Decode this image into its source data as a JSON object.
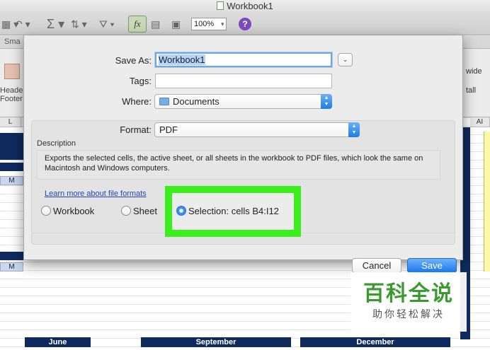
{
  "window": {
    "title": "Workbook1"
  },
  "toolbar": {
    "zoom": "100%",
    "function_label": "fx",
    "help_label": "?"
  },
  "ribbon": {
    "tab_label": "Sma",
    "header_footer_label": "Header\nFooter",
    "wide_label": "wide",
    "tall_label": "tall"
  },
  "sheet": {
    "col_left": "L",
    "col_right": "AI",
    "cell_m1": "M",
    "cell_m2": "M",
    "months": [
      "June",
      "September",
      "December"
    ]
  },
  "dialog": {
    "save_as_label": "Save As:",
    "save_as_value": "Workbook1",
    "tags_label": "Tags:",
    "tags_value": "",
    "where_label": "Where:",
    "where_value": "Documents",
    "format_label": "Format:",
    "format_value": "PDF",
    "description_title": "Description",
    "description_text": "Exports the selected cells, the active sheet, or all sheets in the workbook to PDF files, which look the same on Macintosh and Windows computers.",
    "learn_link": "Learn more about file formats",
    "radio_options": [
      {
        "label": "Workbook",
        "selected": false
      },
      {
        "label": "Sheet",
        "selected": false
      },
      {
        "label": "Selection: cells B4:I12",
        "selected": true
      }
    ],
    "cancel_label": "Cancel",
    "save_label": "Save"
  },
  "watermark": {
    "brand": "百科全说",
    "tagline": "助你轻松解决"
  },
  "colors": {
    "highlight_frame": "#3bef1d",
    "accent": "#1b79ec",
    "navy_fill": "#0f2b5e"
  }
}
